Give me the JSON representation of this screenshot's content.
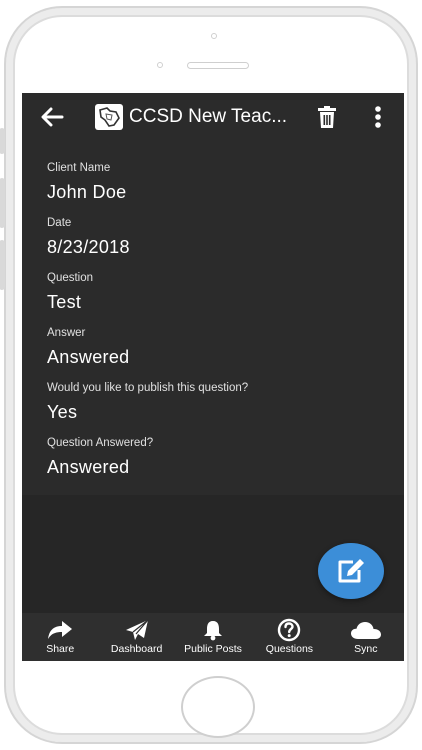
{
  "app": {
    "title": "CCSD New Teac..."
  },
  "fields": [
    {
      "label": "Client Name",
      "value": "John Doe"
    },
    {
      "label": "Date",
      "value": "8/23/2018"
    },
    {
      "label": "Question",
      "value": "Test"
    },
    {
      "label": "Answer",
      "value": "Answered"
    },
    {
      "label": "Would you like to publish this question?",
      "value": "Yes"
    },
    {
      "label": "Question Answered?",
      "value": "Answered"
    }
  ],
  "bottom_nav": [
    {
      "label": "Share",
      "icon": "share-icon"
    },
    {
      "label": "Dashboard",
      "icon": "paper-plane-icon"
    },
    {
      "label": "Public Posts",
      "icon": "bell-icon"
    },
    {
      "label": "Questions",
      "icon": "question-circle-icon"
    },
    {
      "label": "Sync",
      "icon": "cloud-icon"
    }
  ],
  "colors": {
    "screen_bg": "#2b2b2b",
    "fab": "#3c8ed8",
    "text": "#ffffff"
  }
}
